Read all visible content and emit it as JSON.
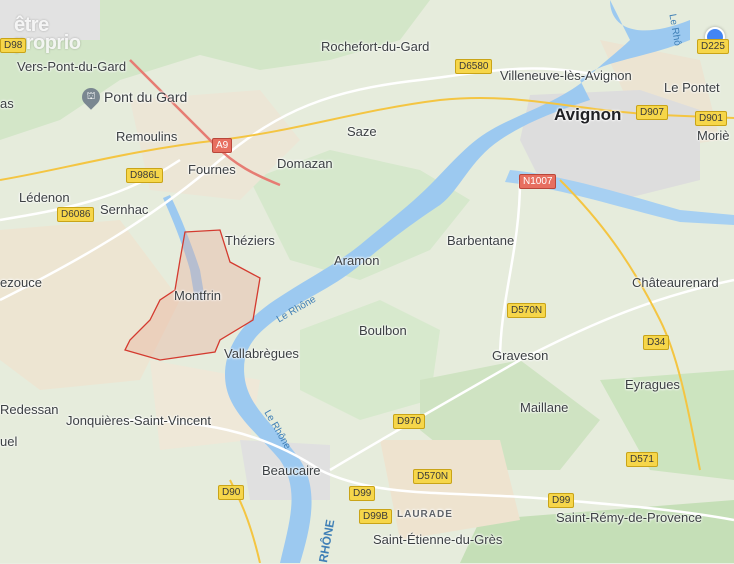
{
  "watermark": {
    "line1": "être",
    "line2": "proprio"
  },
  "places": [
    {
      "id": "rochefort",
      "name": "Rochefort-du-Gard"
    },
    {
      "id": "villeneuve",
      "name": "Villeneuve-lès-Avignon"
    },
    {
      "id": "avignon",
      "name": "Avignon"
    },
    {
      "id": "lepontet",
      "name": "Le Pontet"
    },
    {
      "id": "morie",
      "name": "Moriè"
    },
    {
      "id": "verspontdugard",
      "name": "Vers-Pont-du-Gard"
    },
    {
      "id": "as",
      "name": "as"
    },
    {
      "id": "remoulins",
      "name": "Remoulins"
    },
    {
      "id": "saze",
      "name": "Saze"
    },
    {
      "id": "domazan",
      "name": "Domazan"
    },
    {
      "id": "fournes",
      "name": "Fournes"
    },
    {
      "id": "ledenon",
      "name": "Lédenon"
    },
    {
      "id": "sernhac",
      "name": "Sernhac"
    },
    {
      "id": "theziers",
      "name": "Théziers"
    },
    {
      "id": "barbentane",
      "name": "Barbentane"
    },
    {
      "id": "aramon",
      "name": "Aramon"
    },
    {
      "id": "ezouce",
      "name": "ezouce"
    },
    {
      "id": "montfrin",
      "name": "Montfrin"
    },
    {
      "id": "chateaurenard",
      "name": "Châteaurenard"
    },
    {
      "id": "boulbon",
      "name": "Boulbon"
    },
    {
      "id": "vallabregues",
      "name": "Vallabrègues"
    },
    {
      "id": "graveson",
      "name": "Graveson"
    },
    {
      "id": "eyragues",
      "name": "Eyragues"
    },
    {
      "id": "redessan",
      "name": "Redessan"
    },
    {
      "id": "maillane",
      "name": "Maillane"
    },
    {
      "id": "jonquieres",
      "name": "Jonquières-Saint-Vincent"
    },
    {
      "id": "uel",
      "name": "uel"
    },
    {
      "id": "beaucaire",
      "name": "Beaucaire"
    },
    {
      "id": "stremy",
      "name": "Saint-Rémy-de-Provence"
    },
    {
      "id": "stetienne",
      "name": "Saint-Étienne-du-Grès"
    }
  ],
  "districts": {
    "laurade": "LAURADE"
  },
  "poi": {
    "pontdugard": "Pont du Gard",
    "icon": "monument-icon"
  },
  "rivers": {
    "rhone1": "Le Rhône",
    "rhone2": "Le Rhône",
    "rhone3": "RHÔNE",
    "rhone4": "Le Rhô"
  },
  "roads": [
    {
      "id": "d98",
      "label": "D98",
      "type": "yellow"
    },
    {
      "id": "d6580",
      "label": "D6580",
      "type": "yellow"
    },
    {
      "id": "d225",
      "label": "D225",
      "type": "yellow"
    },
    {
      "id": "d907",
      "label": "D907",
      "type": "yellow"
    },
    {
      "id": "d901",
      "label": "D901",
      "type": "yellow"
    },
    {
      "id": "a9",
      "label": "A9",
      "type": "red"
    },
    {
      "id": "d986l",
      "label": "D986L",
      "type": "yellow"
    },
    {
      "id": "d6086",
      "label": "D6086",
      "type": "yellow"
    },
    {
      "id": "n1007",
      "label": "N1007",
      "type": "red"
    },
    {
      "id": "d570n1",
      "label": "D570N",
      "type": "yellow"
    },
    {
      "id": "d34",
      "label": "D34",
      "type": "yellow"
    },
    {
      "id": "d970",
      "label": "D970",
      "type": "yellow"
    },
    {
      "id": "d571",
      "label": "D571",
      "type": "yellow"
    },
    {
      "id": "d570n2",
      "label": "D570N",
      "type": "yellow"
    },
    {
      "id": "d90",
      "label": "D90",
      "type": "yellow"
    },
    {
      "id": "d99a",
      "label": "D99",
      "type": "yellow"
    },
    {
      "id": "d99b",
      "label": "D99",
      "type": "yellow"
    },
    {
      "id": "d99bb",
      "label": "D99B",
      "type": "yellow"
    }
  ],
  "colors": {
    "water": "#9cc9f0",
    "forest": "#cfe6c4",
    "urban": "#dcdcdc",
    "boundary": "#d43a2f"
  }
}
